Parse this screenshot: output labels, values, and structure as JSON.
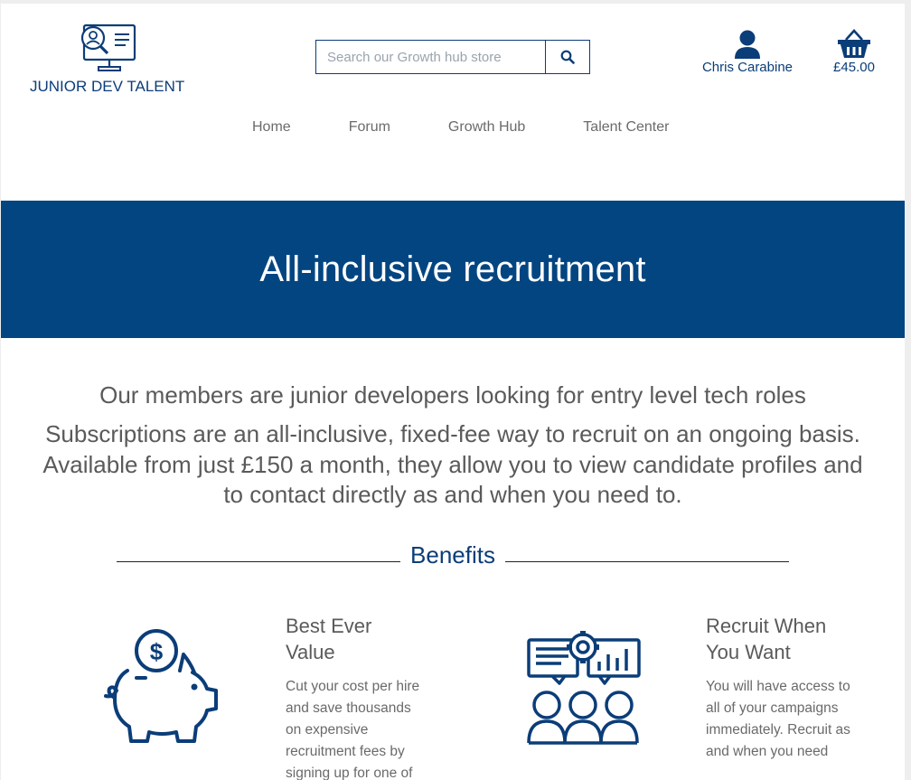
{
  "header": {
    "logo_text": "JUNIOR DEV TALENT",
    "search_placeholder": "Search our Growth hub store",
    "account_name": "Chris Carabine",
    "cart_total": "£45.00"
  },
  "nav": {
    "items": [
      {
        "label": "Home"
      },
      {
        "label": "Forum"
      },
      {
        "label": "Growth Hub"
      },
      {
        "label": "Talent Center"
      }
    ]
  },
  "banner": {
    "title": "All-inclusive recruitment"
  },
  "intro": {
    "line1": "Our members are junior developers looking for entry level tech roles",
    "line2": "Subscriptions are an all-inclusive, fixed-fee way to recruit on an ongoing basis. Available from just £150 a month, they allow you to view candidate profiles and to contact directly as and when you need to."
  },
  "benefits": {
    "heading": "Benefits",
    "items": [
      {
        "icon": "piggy-bank-icon",
        "title": "Best Ever Value",
        "text": "Cut your cost per hire and save thousands on expensive recruitment fees by signing up for one of"
      },
      {
        "icon": "team-analytics-icon",
        "title": "Recruit When You Want",
        "text": "You will have access to all of your campaigns immediately. Recruit as and when you need"
      }
    ]
  },
  "colors": {
    "brand": "#034581",
    "text_muted": "#5a5a5a"
  }
}
